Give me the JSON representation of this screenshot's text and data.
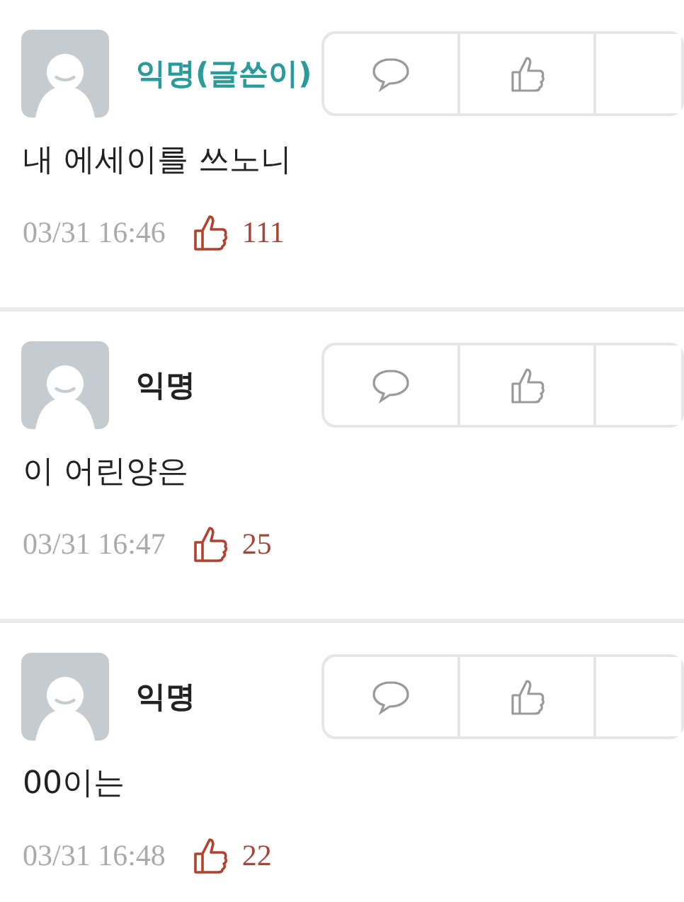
{
  "comments": [
    {
      "author": "익명(글쓴이)",
      "is_author": true,
      "text": "내 에세이를 쓰노니",
      "time": "03/31 16:46",
      "likes": "111"
    },
    {
      "author": "익명",
      "is_author": false,
      "text": "이 어린양은",
      "time": "03/31 16:47",
      "likes": "25"
    },
    {
      "author": "익명",
      "is_author": false,
      "text": "00이는",
      "time": "03/31 16:48",
      "likes": "22"
    }
  ]
}
